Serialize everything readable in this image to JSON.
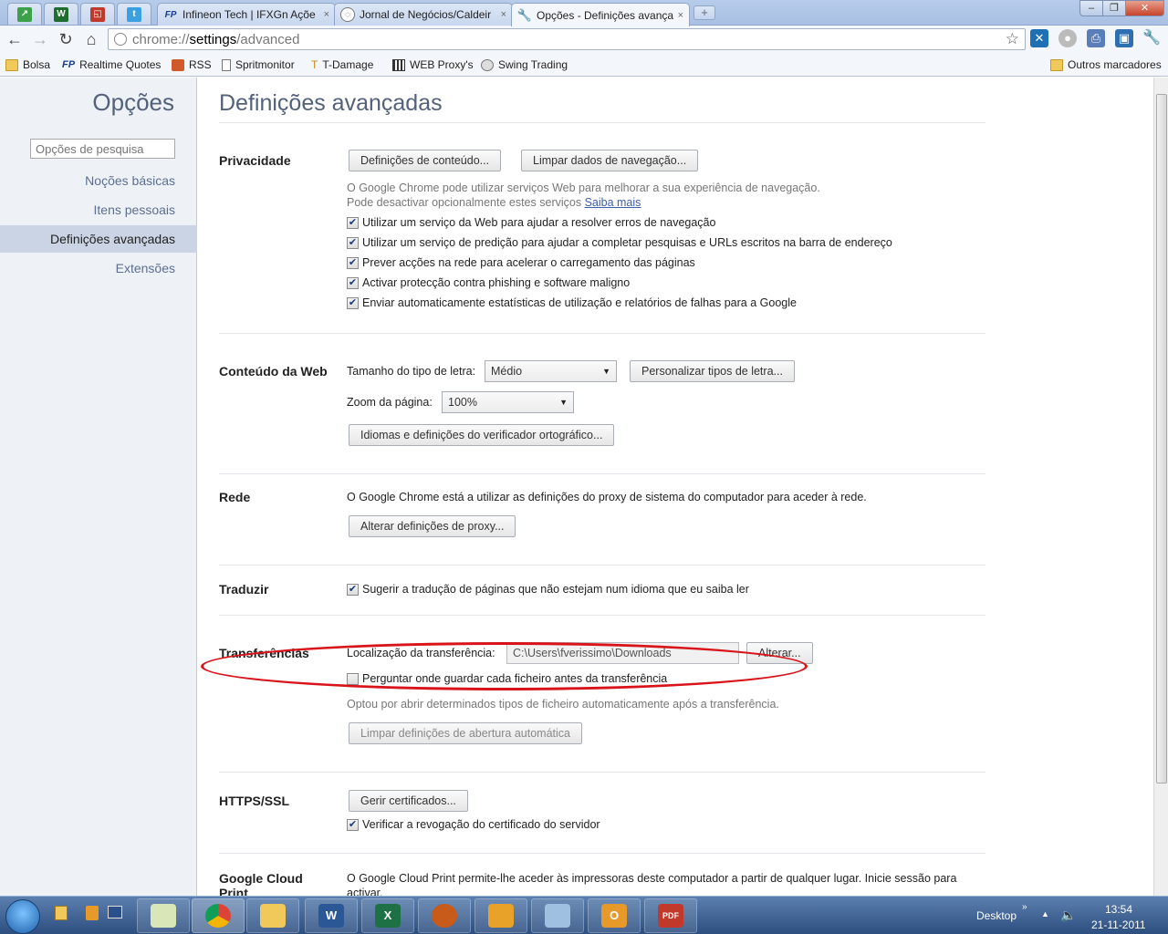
{
  "colors": {
    "accent": "#53627a",
    "link": "#3b5ea8",
    "annotation": "#d8141a",
    "sidebar_selected": "#cad4e4"
  },
  "tabs": {
    "pinned": [
      {
        "icon": "chart-icon"
      },
      {
        "icon": "w-app-icon"
      },
      {
        "icon": "gadget-icon"
      },
      {
        "icon": "twitter-icon"
      }
    ],
    "items": [
      {
        "title": "Infineon Tech | IFXGn Açõe",
        "icon": "fp-icon",
        "active": false
      },
      {
        "title": "Jornal de Negócios/Caldeir",
        "icon": "globe-icon",
        "active": false
      },
      {
        "title": "Opções - Definições avança",
        "icon": "wrench-icon",
        "active": true
      }
    ],
    "close_glyph": "×",
    "newtab_glyph": "+"
  },
  "window_controls": {
    "minimize": "–",
    "maximize": "❐",
    "close": "✕"
  },
  "toolbar": {
    "url_scheme": "chrome://",
    "url_host": "settings",
    "url_path": "/advanced"
  },
  "bookmarks": [
    {
      "label": "Bolsa",
      "icon": "folder-icon"
    },
    {
      "label": "Realtime Quotes",
      "icon": "fp-icon"
    },
    {
      "label": "RSS",
      "icon": "rss-icon"
    },
    {
      "label": "Spritmonitor",
      "icon": "page-icon"
    },
    {
      "label": "T-Damage",
      "icon": "td-icon"
    },
    {
      "label": "WEB Proxy's",
      "icon": "grid-icon"
    },
    {
      "label": "Swing Trading",
      "icon": "globe-icon"
    }
  ],
  "other_bookmarks": "Outros marcadores",
  "sidebar": {
    "title": "Opções",
    "search_placeholder": "Opções de pesquisa",
    "items": [
      {
        "label": "Noções básicas",
        "selected": false
      },
      {
        "label": "Itens pessoais",
        "selected": false
      },
      {
        "label": "Definições avançadas",
        "selected": true
      },
      {
        "label": "Extensões",
        "selected": false
      }
    ]
  },
  "page": {
    "title": "Definições avançadas",
    "privacy": {
      "title": "Privacidade",
      "content_settings_btn": "Definições de conteúdo...",
      "clear_data_btn": "Limpar dados de navegação...",
      "desc_line1": "O Google Chrome pode utilizar serviços Web para melhorar a sua experiência de navegação.",
      "desc_line2": "Pode desactivar opcionalmente estes serviços",
      "learn_more": "Saiba mais",
      "checkboxes": [
        {
          "label": "Utilizar um serviço da Web para ajudar a resolver erros de navegação",
          "checked": true
        },
        {
          "label": "Utilizar um serviço de predição para ajudar a completar pesquisas e URLs escritos na barra de endereço",
          "checked": true
        },
        {
          "label": "Prever acções na rede para acelerar o carregamento das páginas",
          "checked": true
        },
        {
          "label": "Activar protecção contra phishing e software maligno",
          "checked": true
        },
        {
          "label": "Enviar automaticamente estatísticas de utilização e relatórios de falhas para a Google",
          "checked": true
        }
      ]
    },
    "web_content": {
      "title": "Conteúdo da Web",
      "font_size_label": "Tamanho do tipo de letra:",
      "font_size_value": "Médio",
      "customize_fonts_btn": "Personalizar tipos de letra...",
      "zoom_label": "Zoom da página:",
      "zoom_value": "100%",
      "languages_btn": "Idiomas e definições do verificador ortográfico..."
    },
    "network": {
      "title": "Rede",
      "desc": "O Google Chrome está a utilizar as definições do proxy de sistema do computador para aceder à rede.",
      "proxy_btn": "Alterar definições de proxy..."
    },
    "translate": {
      "title": "Traduzir",
      "checkbox": {
        "label": "Sugerir a tradução de páginas que não estejam num idioma que eu saiba ler",
        "checked": true
      }
    },
    "downloads": {
      "title": "Transferências",
      "location_label": "Localização da transferência:",
      "location_value": "C:\\Users\\fverissimo\\Downloads",
      "change_btn": "Alterar...",
      "ask_checkbox": {
        "label": "Perguntar onde guardar cada ficheiro antes da transferência",
        "checked": false
      },
      "auto_open_desc": "Optou por abrir determinados tipos de ficheiro automaticamente após a transferência.",
      "reset_auto_open_btn": "Limpar definições de abertura automática"
    },
    "https": {
      "title": "HTTPS/SSL",
      "certs_btn": "Gerir certificados...",
      "revocation_checkbox": {
        "label": "Verificar a revogação do certificado do servidor",
        "checked": true
      }
    },
    "cloud_print": {
      "title_line1": "Google Cloud",
      "title_line2": "Print",
      "desc_line1": "O Google Cloud Print permite-lhe aceder às impressoras deste computador a partir de qualquer lugar. Inicie sessão para",
      "desc_line2": "activar."
    }
  },
  "taskbar": {
    "apps": [
      "explorer-icon",
      "chrome-icon",
      "folder-icon",
      "word-icon",
      "excel-icon",
      "firefox-icon",
      "bird-icon",
      "notepad-icon",
      "outlook-icon",
      "pdf-icon"
    ],
    "desktop_label": "Desktop",
    "time": "13:54",
    "date": "21-11-2011"
  }
}
